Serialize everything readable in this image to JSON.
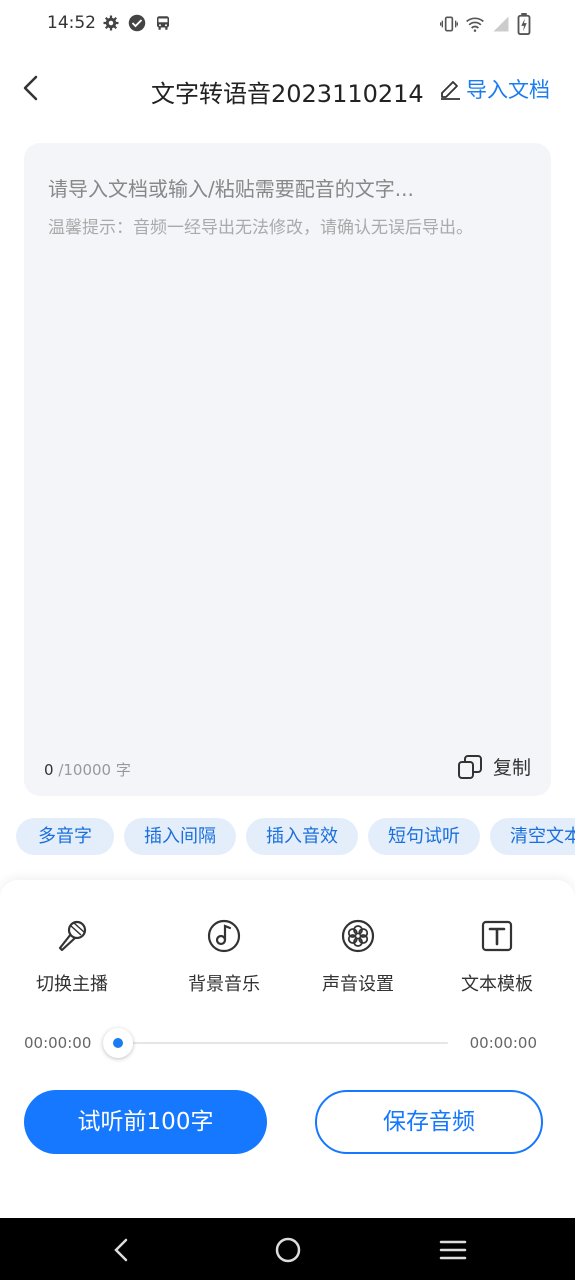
{
  "status_bar": {
    "time": "14:52"
  },
  "header": {
    "title": "文字转语音2023110214",
    "import_label": "导入文档"
  },
  "editor": {
    "placeholder": "请导入文档或输入/粘贴需要配音的文字...",
    "tip": "温馨提示：音频一经导出无法修改，请确认无误后导出。",
    "char_count": "0",
    "char_limit": "/10000 字",
    "copy_label": "复制"
  },
  "chips": [
    {
      "label": "多音字"
    },
    {
      "label": "插入间隔"
    },
    {
      "label": "插入音效"
    },
    {
      "label": "短句试听"
    },
    {
      "label": "清空文本"
    }
  ],
  "tools": [
    {
      "label": "切换主播",
      "icon": "microphone-icon"
    },
    {
      "label": "背景音乐",
      "icon": "music-disc-icon"
    },
    {
      "label": "声音设置",
      "icon": "settings-flower-icon"
    },
    {
      "label": "文本模板",
      "icon": "text-template-icon"
    }
  ],
  "player": {
    "start_time": "00:00:00",
    "end_time": "00:00:00",
    "progress": 0
  },
  "actions": {
    "preview_label": "试听前100字",
    "save_label": "保存音频"
  },
  "colors": {
    "accent": "#1677ff",
    "chip_bg": "#e4eefb",
    "editor_bg": "#f3f5f9"
  }
}
